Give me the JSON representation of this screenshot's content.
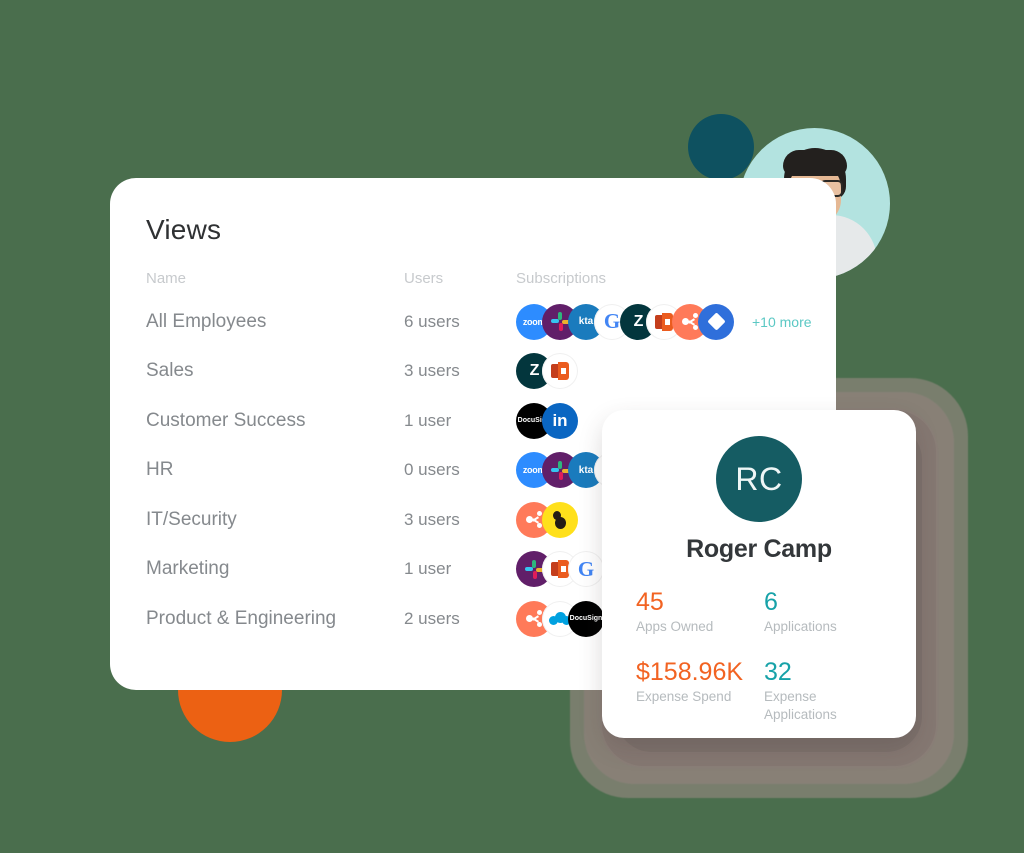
{
  "theme": {
    "background": "#4a6e4d",
    "card_background": "#ffffff",
    "accent_orange": "#f26322",
    "accent_teal": "#17a2a8",
    "link_teal": "#5bc8c4",
    "avatar_teal": "#155c63",
    "dot_teal": "#0e5160",
    "orange_shape": "#ec6113",
    "photo_background": "#b3e3e0"
  },
  "views_panel": {
    "title": "Views",
    "columns": {
      "name": "Name",
      "users": "Users",
      "subscriptions": "Subscriptions"
    },
    "rows": [
      {
        "name": "All Employees",
        "users": "6 users",
        "apps": [
          "zoom",
          "slack",
          "okta",
          "google",
          "zendesk",
          "office",
          "hubspot",
          "blue-diamond"
        ],
        "more": "+10 more"
      },
      {
        "name": "Sales",
        "users": "3 users",
        "apps": [
          "zendesk",
          "office"
        ],
        "more": ""
      },
      {
        "name": "Customer Success",
        "users": "1 user",
        "apps": [
          "docusign",
          "linkedin"
        ],
        "more": ""
      },
      {
        "name": "HR",
        "users": "0 users",
        "apps": [
          "zoom",
          "slack",
          "okta",
          "google"
        ],
        "more": ""
      },
      {
        "name": "IT/Security",
        "users": "3 users",
        "apps": [
          "hubspot",
          "mailchimp"
        ],
        "more": ""
      },
      {
        "name": "Marketing",
        "users": "1 user",
        "apps": [
          "slack",
          "office",
          "google"
        ],
        "more": ""
      },
      {
        "name": "Product & Engineering",
        "users": "2 users",
        "apps": [
          "hubspot",
          "salesforce",
          "docusign"
        ],
        "more": ""
      }
    ]
  },
  "profile_card": {
    "avatar_initials": "RC",
    "name": "Roger Camp",
    "stats": [
      {
        "value": "45",
        "label": "Apps Owned",
        "color": "orange"
      },
      {
        "value": "6",
        "label": "Applications",
        "color": "teal"
      },
      {
        "value": "$158.96K",
        "label": "Expense Spend",
        "color": "orange"
      },
      {
        "value": "32",
        "label": "Expense\nApplications",
        "color": "teal"
      }
    ]
  },
  "decorations": {
    "user_photo_alt": "smiling man with glasses",
    "teal_dot": "teal-circle",
    "orange_half_circle": "orange-half-circle"
  }
}
